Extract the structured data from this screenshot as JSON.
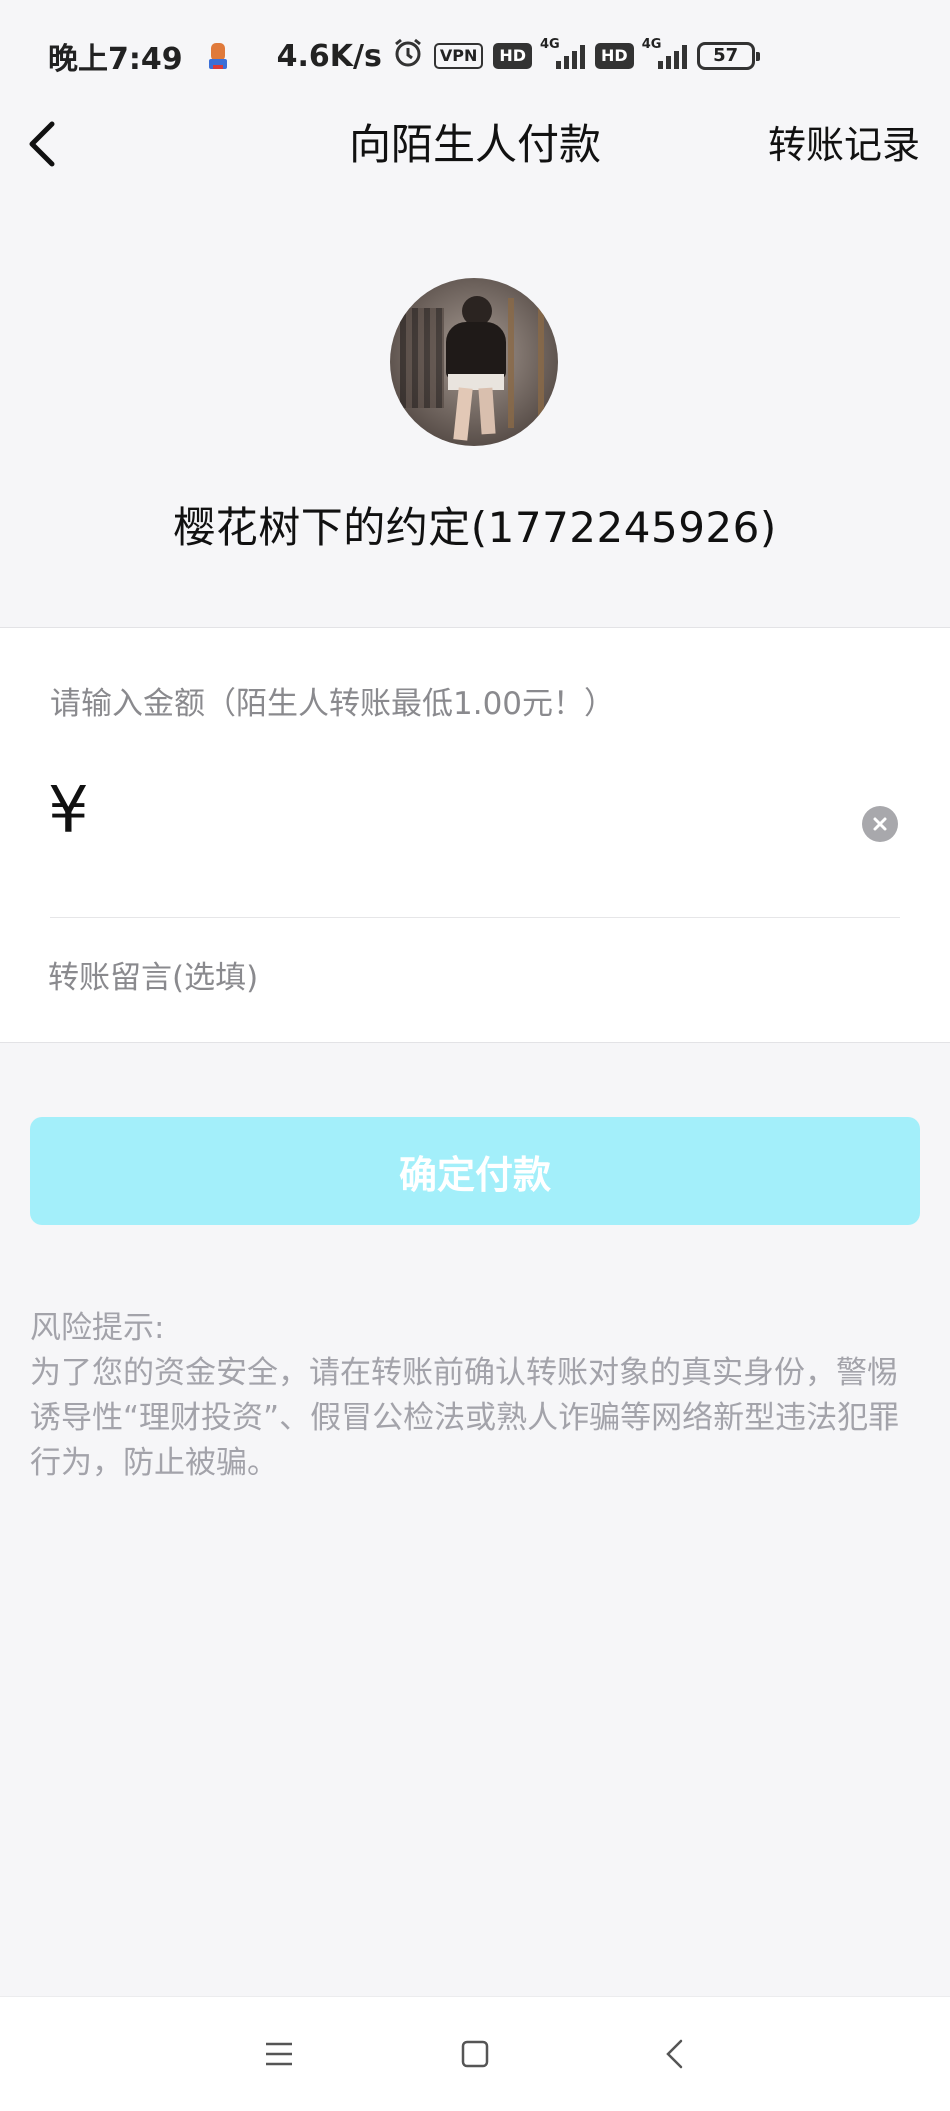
{
  "status_bar": {
    "time": "晚上7:49",
    "net_speed": "4.6K/s",
    "vpn": "VPN",
    "hd1": "HD",
    "net1": "4G",
    "hd2": "HD",
    "net2": "4G",
    "battery": "57"
  },
  "header": {
    "title": "向陌生人付款",
    "right_link": "转账记录"
  },
  "payee": {
    "name": "樱花树下的约定(1772245926)"
  },
  "amount": {
    "hint": "请输入金额（陌生人转账最低1.00元！）",
    "currency_symbol": "¥",
    "value": ""
  },
  "remark": {
    "placeholder": "转账留言(选填)"
  },
  "confirm_button": {
    "label": "确定付款"
  },
  "risk_notice": {
    "title": "风险提示:",
    "body": "为了您的资金安全，请在转账前确认转账对象的真实身份，警惕诱导性“理财投资”、假冒公检法或熟人诈骗等网络新型违法犯罪行为，防止被骗。"
  },
  "colors": {
    "background": "#f6f6f8",
    "confirm_button_bg": "#a3effa",
    "hint_text": "#8a8a8e",
    "risk_text": "#a3a3aa"
  }
}
